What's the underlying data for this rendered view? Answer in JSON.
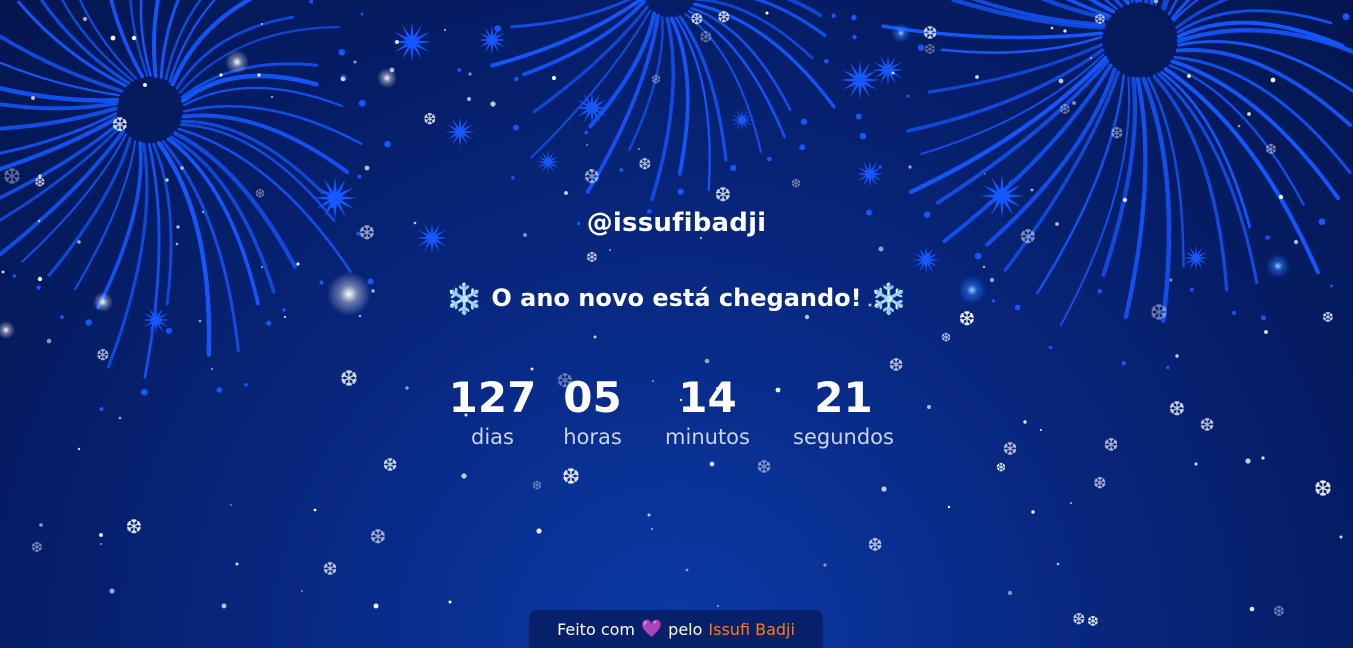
{
  "header": {
    "username": "@issufibadji"
  },
  "headline": {
    "left_icon": "❄️",
    "text": "O ano novo está chegando!",
    "right_icon": "❄️"
  },
  "countdown": [
    {
      "value": "127",
      "label": "dias"
    },
    {
      "value": "05",
      "label": "horas"
    },
    {
      "value": "14",
      "label": "minutos"
    },
    {
      "value": "21",
      "label": "segundos"
    }
  ],
  "footer": {
    "prefix": "Feito com",
    "heart": "💜",
    "middle": "pelo",
    "author": "Issufi Badji"
  },
  "colors": {
    "background": "#051d66",
    "firework": "#1457ff",
    "author_link": "#ff7a18",
    "heart": "#b46be8"
  }
}
